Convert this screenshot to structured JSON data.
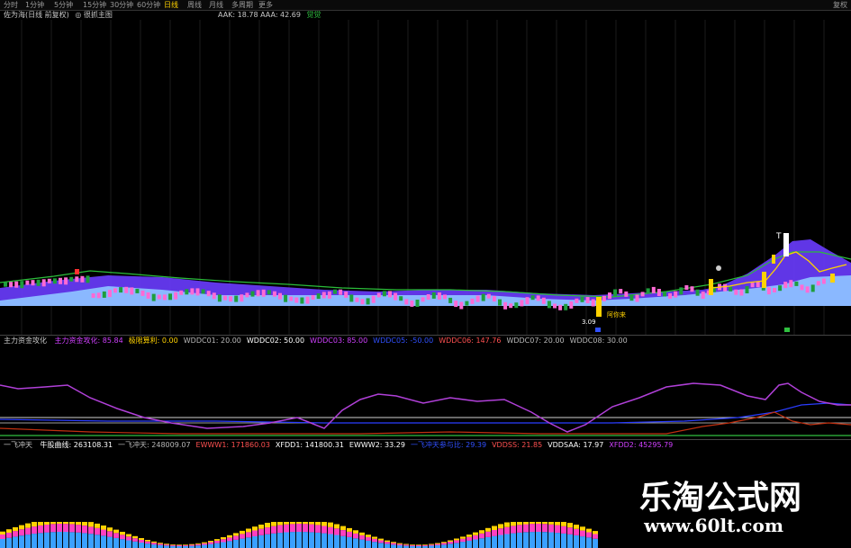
{
  "toolbar": {
    "tabs": [
      "分时",
      "1分钟",
      "5分钟",
      "15分钟",
      "30分钟",
      "60分钟",
      "日线",
      "周线",
      "月线",
      "多周期",
      "更多"
    ],
    "active_tab": "日线",
    "close_label": "复权"
  },
  "main_panel": {
    "title": "佐为海(日线 前复权)",
    "option": "◎ 很抓主图",
    "stats_label": "AAK: 18.78  AAA: 42.69",
    "stats_extra": "觉觉",
    "marker_value": "3.09",
    "marker_label": "阿你来",
    "top_marker": "T"
  },
  "indicator1": {
    "name": "主力资金攻化",
    "items": [
      {
        "label": "主力资金攻化",
        "value": "85.84",
        "color": "#d040ff"
      },
      {
        "label": "极限算利",
        "value": "0.00",
        "color": "#ffd200"
      },
      {
        "label": "WDDC01",
        "value": "20.00",
        "color": "#b8b8b8"
      },
      {
        "label": "WDDC02",
        "value": "50.00",
        "color": "#ffffff"
      },
      {
        "label": "WDDC03",
        "value": "85.00",
        "color": "#d040ff"
      },
      {
        "label": "WDDC05",
        "value": "-50.00",
        "color": "#3050ff"
      },
      {
        "label": "WDDC06",
        "value": "147.76",
        "color": "#ff5050"
      },
      {
        "label": "WDDC07",
        "value": "20.00",
        "color": "#b8b8b8"
      },
      {
        "label": "WDDC08",
        "value": "30.00",
        "color": "#b8b8b8"
      }
    ]
  },
  "indicator2": {
    "name": "一飞冲天",
    "items": [
      {
        "label": "牛股曲线",
        "value": "263108.31",
        "color": "#ffffff"
      },
      {
        "label": "一飞冲天",
        "value": "248009.07",
        "color": "#b8b8b8"
      },
      {
        "label": "EWWW1",
        "value": "171860.03",
        "color": "#ff5050"
      },
      {
        "label": "XFDD1",
        "value": "141800.31",
        "color": "#ffffff"
      },
      {
        "label": "EWWW2",
        "value": "33.29",
        "color": "#ffffff"
      },
      {
        "label": "一飞冲天参与比",
        "value": "29.39",
        "color": "#3050ff"
      },
      {
        "label": "VDDSS",
        "value": "21.85",
        "color": "#ff5050"
      },
      {
        "label": "VDDSAA",
        "value": "17.97",
        "color": "#ffffff"
      },
      {
        "label": "XFDD2",
        "value": "45295.79",
        "color": "#d040ff"
      }
    ]
  },
  "watermark": {
    "text": "乐淘公式网",
    "url": "www.60lt.com"
  },
  "colors": {
    "band_purple": "#6a3cff",
    "band_light": "#8ab8ff",
    "up_candle": "#ff6ad5",
    "down_candle": "#1e9e3c",
    "yellow": "#ffd200",
    "indicator_purple": "#b040d8",
    "indicator_blue": "#2a3cff",
    "indicator_red": "#c03010",
    "indicator_green": "#30c040"
  }
}
